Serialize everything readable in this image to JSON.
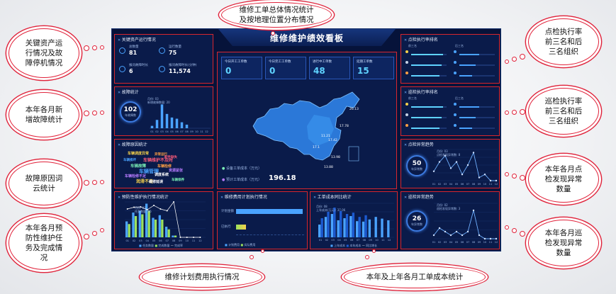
{
  "header": {
    "title": "维修维护绩效看板"
  },
  "callouts": {
    "top": "维修工单总体情况统计\n及按地理位置分布情况",
    "left1": "关键资产运\n行情况及故\n障停机情况",
    "left2": "本年各月新\n增故障统计",
    "left3": "故障原因词\n云统计",
    "left4": "本年各月预\n防性维护任\n务及完成情\n况",
    "bottom1": "维修计划费用执行情况",
    "bottom2": "本年及上年各月工单成本统计",
    "right1": "点检执行率\n前三名和后\n三名组织",
    "right2": "巡检执行率\n前三名和后\n三名组织",
    "right3": "本年各月点\n检发现异常\n数量",
    "right4": "本年各月巡\n检发现异常\n数量"
  },
  "assets": {
    "title": "关键资产运行情况",
    "items": [
      {
        "label": "总数量",
        "value": "81"
      },
      {
        "label": "运行数量",
        "value": "75"
      },
      {
        "label": "报问故障时长",
        "value": "6"
      },
      {
        "label": "报问故障时长(分钟)",
        "value": "11,574"
      }
    ]
  },
  "faults": {
    "title": "故障统计",
    "total": "102",
    "total_label": "年故障数",
    "legend": "月份: 03",
    "legend2": "新增故障数量: 20"
  },
  "cause": {
    "title": "故障原因统计",
    "words": [
      "车辆调度异常",
      "车辆维护不及时",
      "车辆故障",
      "车辆管理",
      "调度系统",
      "车辆检修不足",
      "车辆检修",
      "润滑不足",
      "配件缺失",
      "车辆保养",
      "车辆损坏",
      "维修延误",
      "资源紧张",
      "异常运行"
    ]
  },
  "pm": {
    "title": "预防性维护执行情况统计",
    "legend_a": "任务数量",
    "legend_b": "完成数量",
    "legend_c": "完成率",
    "tooltip1": "月份: 03",
    "tooltip2": "任务数量: 86"
  },
  "workorders": {
    "cards": [
      {
        "label": "今日开工工单数",
        "value": "0"
      },
      {
        "label": "今日完工工单数",
        "value": "0"
      },
      {
        "label": "进行中工单数",
        "value": "48"
      },
      {
        "label": "延期工单数",
        "value": "15"
      }
    ],
    "map_labels": [
      "26.13",
      "17.78",
      "11.21",
      "17.42",
      "13.98",
      "17.1",
      "13.88"
    ],
    "cost_label": "设备工单成本（万元）",
    "cost_label2": "预计工单成本（万元）",
    "cost_value": "196.18"
  },
  "budget": {
    "title": "维修费用计划执行情况",
    "row1": "计划金额",
    "row2": "已执行",
    "legend": [
      "计划费用",
      "实际费用"
    ]
  },
  "cost": {
    "title": "工单成本同比统计",
    "tooltip1": "月份: 08",
    "tooltip2": "上年成本(万元): 37.06",
    "legend": [
      "上年成本",
      "本年成本",
      "同比增长"
    ]
  },
  "spot_rank": {
    "title": "点检执行率排名",
    "col_top": "前三名",
    "col_bottom": "后三名"
  },
  "patrol_rank": {
    "title": "巡检执行率排名",
    "col_top": "前三名",
    "col_bottom": "后三名"
  },
  "spot_trend": {
    "title": "点检异常趋势",
    "total": "50",
    "total_label": "年异常数",
    "tooltip1": "月份: 03",
    "tooltip2": "点检发现异常数: 8"
  },
  "patrol_trend": {
    "title": "巡检异常趋势",
    "total": "26",
    "total_label": "年异常数",
    "tooltip1": "月份: 02",
    "tooltip2": "巡检发现异常数: 3"
  },
  "chart_data": [
    {
      "type": "bar",
      "name": "faults-monthly",
      "categories": [
        "01",
        "02",
        "03",
        "04",
        "05",
        "06",
        "07",
        "08",
        "09",
        "10",
        "11",
        "12"
      ],
      "values": [
        2,
        7,
        20,
        12,
        9,
        8,
        5,
        3,
        0,
        0,
        0,
        0
      ]
    },
    {
      "type": "bar",
      "name": "pm-monthly",
      "categories": [
        "01",
        "02",
        "03",
        "04",
        "05",
        "06",
        "07",
        "08",
        "09",
        "10",
        "11",
        "12"
      ],
      "series": [
        {
          "values": [
            18,
            28,
            30,
            38,
            22,
            25,
            12,
            2,
            0,
            0,
            0,
            0
          ]
        },
        {
          "values": [
            15,
            24,
            26,
            30,
            20,
            20,
            9,
            2,
            0,
            0,
            0,
            0
          ]
        }
      ],
      "line": [
        80,
        85,
        86,
        78,
        90,
        80,
        75,
        100,
        0,
        0,
        0,
        0
      ]
    },
    {
      "type": "bar",
      "name": "cost-yoy",
      "categories": [
        "01",
        "02",
        "03",
        "04",
        "05",
        "06",
        "07",
        "08",
        "09",
        "10",
        "11",
        "12"
      ],
      "series": [
        {
          "values": [
            30,
            48,
            55,
            40,
            45,
            50,
            38,
            37,
            42,
            48,
            44,
            40
          ]
        },
        {
          "values": [
            45,
            60,
            70,
            62,
            55,
            58,
            48,
            52,
            0,
            0,
            0,
            0
          ]
        }
      ]
    },
    {
      "type": "line",
      "name": "spot-abnormal",
      "categories": [
        "01",
        "02",
        "03",
        "04",
        "05",
        "06",
        "07",
        "08",
        "09",
        "10",
        "11",
        "12"
      ],
      "values": [
        3,
        6,
        8,
        4,
        6,
        2,
        5,
        9,
        1,
        2,
        0,
        0
      ]
    },
    {
      "type": "line",
      "name": "patrol-abnormal",
      "categories": [
        "01",
        "02",
        "03",
        "04",
        "05",
        "06",
        "07",
        "08",
        "09",
        "10",
        "11",
        "12"
      ],
      "values": [
        1,
        3,
        2,
        1,
        2,
        1,
        2,
        8,
        1,
        0,
        0,
        0
      ]
    }
  ]
}
